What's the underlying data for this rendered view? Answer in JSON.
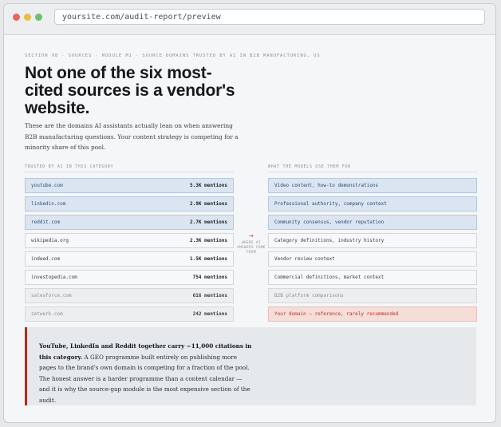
{
  "browser": {
    "url": "yoursite.com/audit-report/preview"
  },
  "report": {
    "eyebrow": "SECTION 08 · SOURCES · MODULE M1 · SOURCE DOMAINS TRUSTED BY AI IN B2B MANUFACTURING, US",
    "headline": "Not one of the six most-cited sources is a vendor's website.",
    "intro": "These are the domains AI assistants actually lean on when answering B2B manufacturing questions. Your content strategy is competing for a minority share of this pool.",
    "left_header": "TRUSTED BY AI IN THIS CATEGORY",
    "right_header": "WHAT THE MODELS USE THEM FOR",
    "mid_label": "WHERE AI ANSWERS COME FROM",
    "mid_arrow": "→",
    "sources": [
      {
        "domain": "youtube.com",
        "mentions": "5.3K mentions",
        "use": "Video content, how-to demonstrations",
        "style": "blue"
      },
      {
        "domain": "linkedin.com",
        "mentions": "2.9K mentions",
        "use": "Professional authority, company context",
        "style": "blue"
      },
      {
        "domain": "reddit.com",
        "mentions": "2.7K mentions",
        "use": "Community consensus, vendor reputation",
        "style": "blue"
      },
      {
        "domain": "wikipedia.org",
        "mentions": "2.3K mentions",
        "use": "Category definitions, industry history",
        "style": "plain"
      },
      {
        "domain": "indeed.com",
        "mentions": "1.5K mentions",
        "use": "Vendor review context",
        "style": "plain"
      },
      {
        "domain": "investopedia.com",
        "mentions": "754 mentions",
        "use": "Commercial definitions, market context",
        "style": "plain"
      },
      {
        "domain": "salesforce.com",
        "mentions": "616 mentions",
        "use": "B2B platform comparisons",
        "style": "mute"
      },
      {
        "domain": "zetwerk.com",
        "mentions": "242 mentions",
        "use": "Your domain — reference, rarely recommended",
        "style": "warn"
      }
    ],
    "callout": {
      "lead": "YouTube, LinkedIn and Reddit together carry ~11,000 citations in this category.",
      "body": " A GEO programme built entirely on publishing more pages to the brand's own domain is competing for a fraction of the pool. The honest answer is a harder programme than a content calendar — and it is why the source-gap module is the most expensive section of the audit."
    }
  },
  "colors": {
    "accent_red": "#b22d22",
    "highlight_blue": "#dbe5f2",
    "warn_bg": "#f5ddd8"
  }
}
